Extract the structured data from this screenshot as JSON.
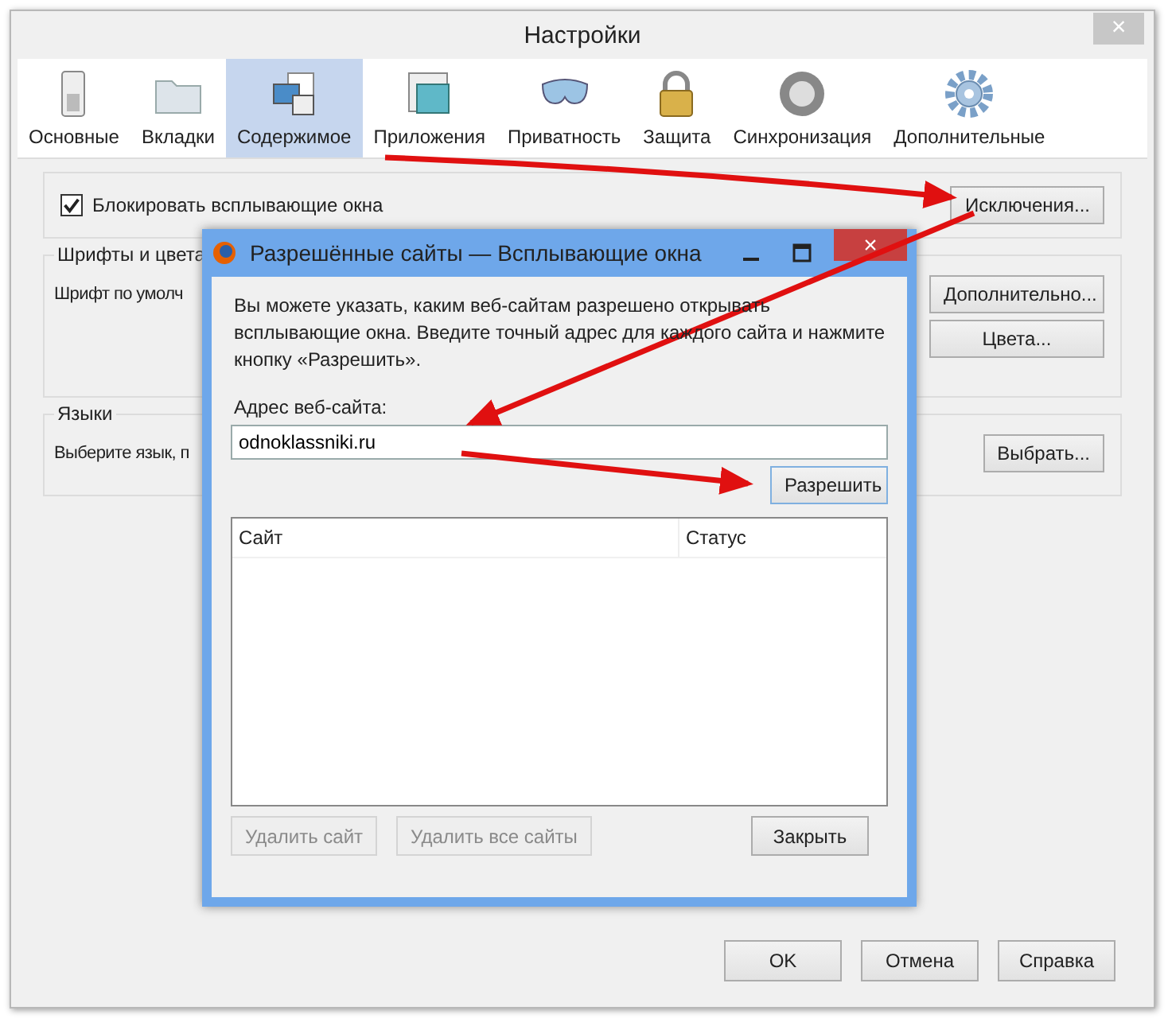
{
  "window": {
    "title": "Настройки",
    "close": "×"
  },
  "tabs": [
    {
      "label": "Основные",
      "selected": false
    },
    {
      "label": "Вкладки",
      "selected": false
    },
    {
      "label": "Содержимое",
      "selected": true
    },
    {
      "label": "Приложения",
      "selected": false
    },
    {
      "label": "Приватность",
      "selected": false
    },
    {
      "label": "Защита",
      "selected": false
    },
    {
      "label": "Синхронизация",
      "selected": false
    },
    {
      "label": "Дополнительные",
      "selected": false
    }
  ],
  "popups": {
    "label": "Блокировать всплывающие окна",
    "checked": true,
    "button": "Исключения..."
  },
  "fonts": {
    "legend": "Шрифты и цвета",
    "label": "Шрифт по умолч",
    "buttons": [
      "Дополнительно...",
      "Цвета..."
    ]
  },
  "languages": {
    "legend": "Языки",
    "label": "Выберите язык, п",
    "button": "Выбрать..."
  },
  "buttons": [
    "OK",
    "Отмена",
    "Справка"
  ],
  "dialog": {
    "title": "Разрешённые сайты — Всплывающие окна",
    "close": "×",
    "description": "Вы можете указать, каким веб-сайтам разрешено открывать всплывающие окна. Введите точный адрес для каждого сайта и нажмите кнопку «Разрешить».",
    "address_label": "Адрес веб-сайта:",
    "address_value": "odnoklassniki.ru",
    "allow_button": "Разрешить",
    "table": {
      "columns": [
        "Сайт",
        "Статус"
      ]
    },
    "buttons": [
      {
        "label": "Удалить сайт",
        "disabled": true
      },
      {
        "label": "Удалить все сайты",
        "disabled": true
      },
      {
        "label": "Закрыть",
        "disabled": false
      }
    ]
  }
}
